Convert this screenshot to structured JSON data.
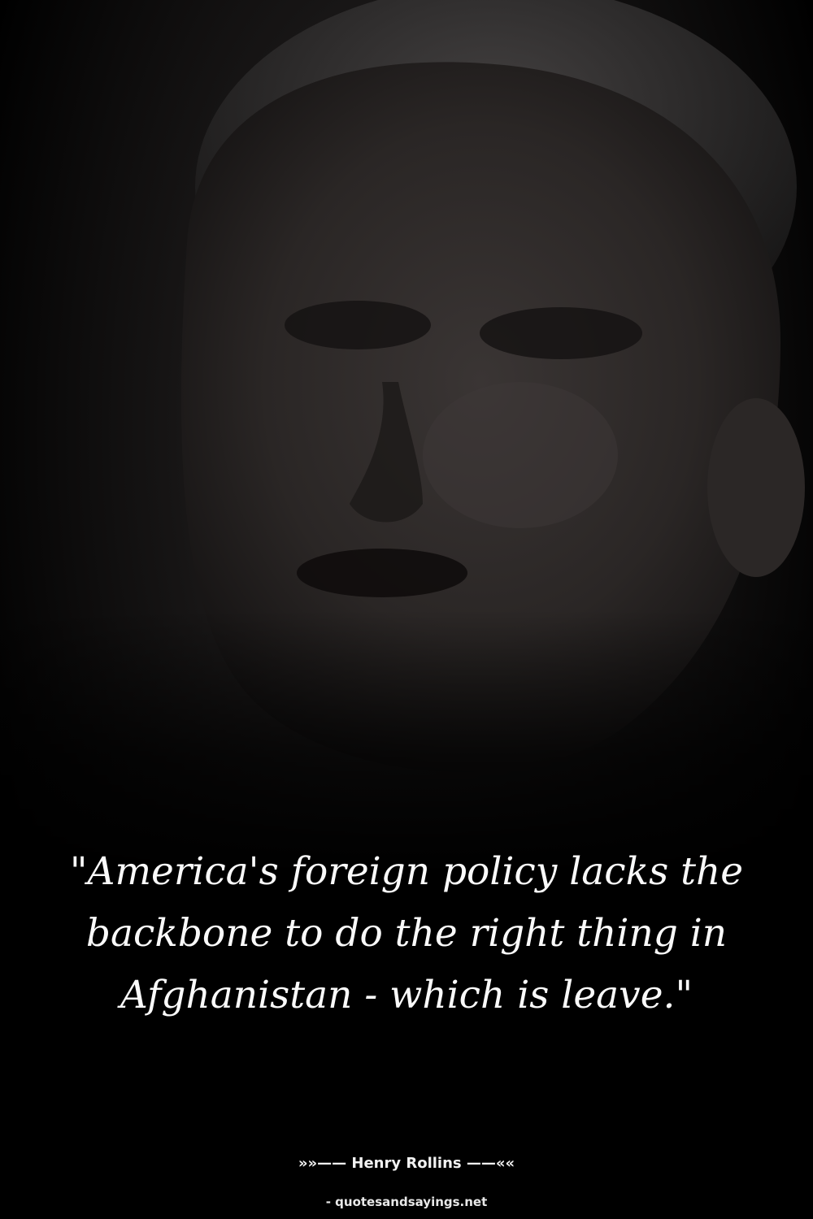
{
  "quote": {
    "text": "\"America's foreign policy lacks the backbone to do the right thing in Afghanistan - which is leave.\"",
    "author_line": "»»—— Henry Rollins ——««",
    "source": "- quotesandsayings.net"
  },
  "colors": {
    "background": "#000000",
    "text": "#fafafa"
  }
}
